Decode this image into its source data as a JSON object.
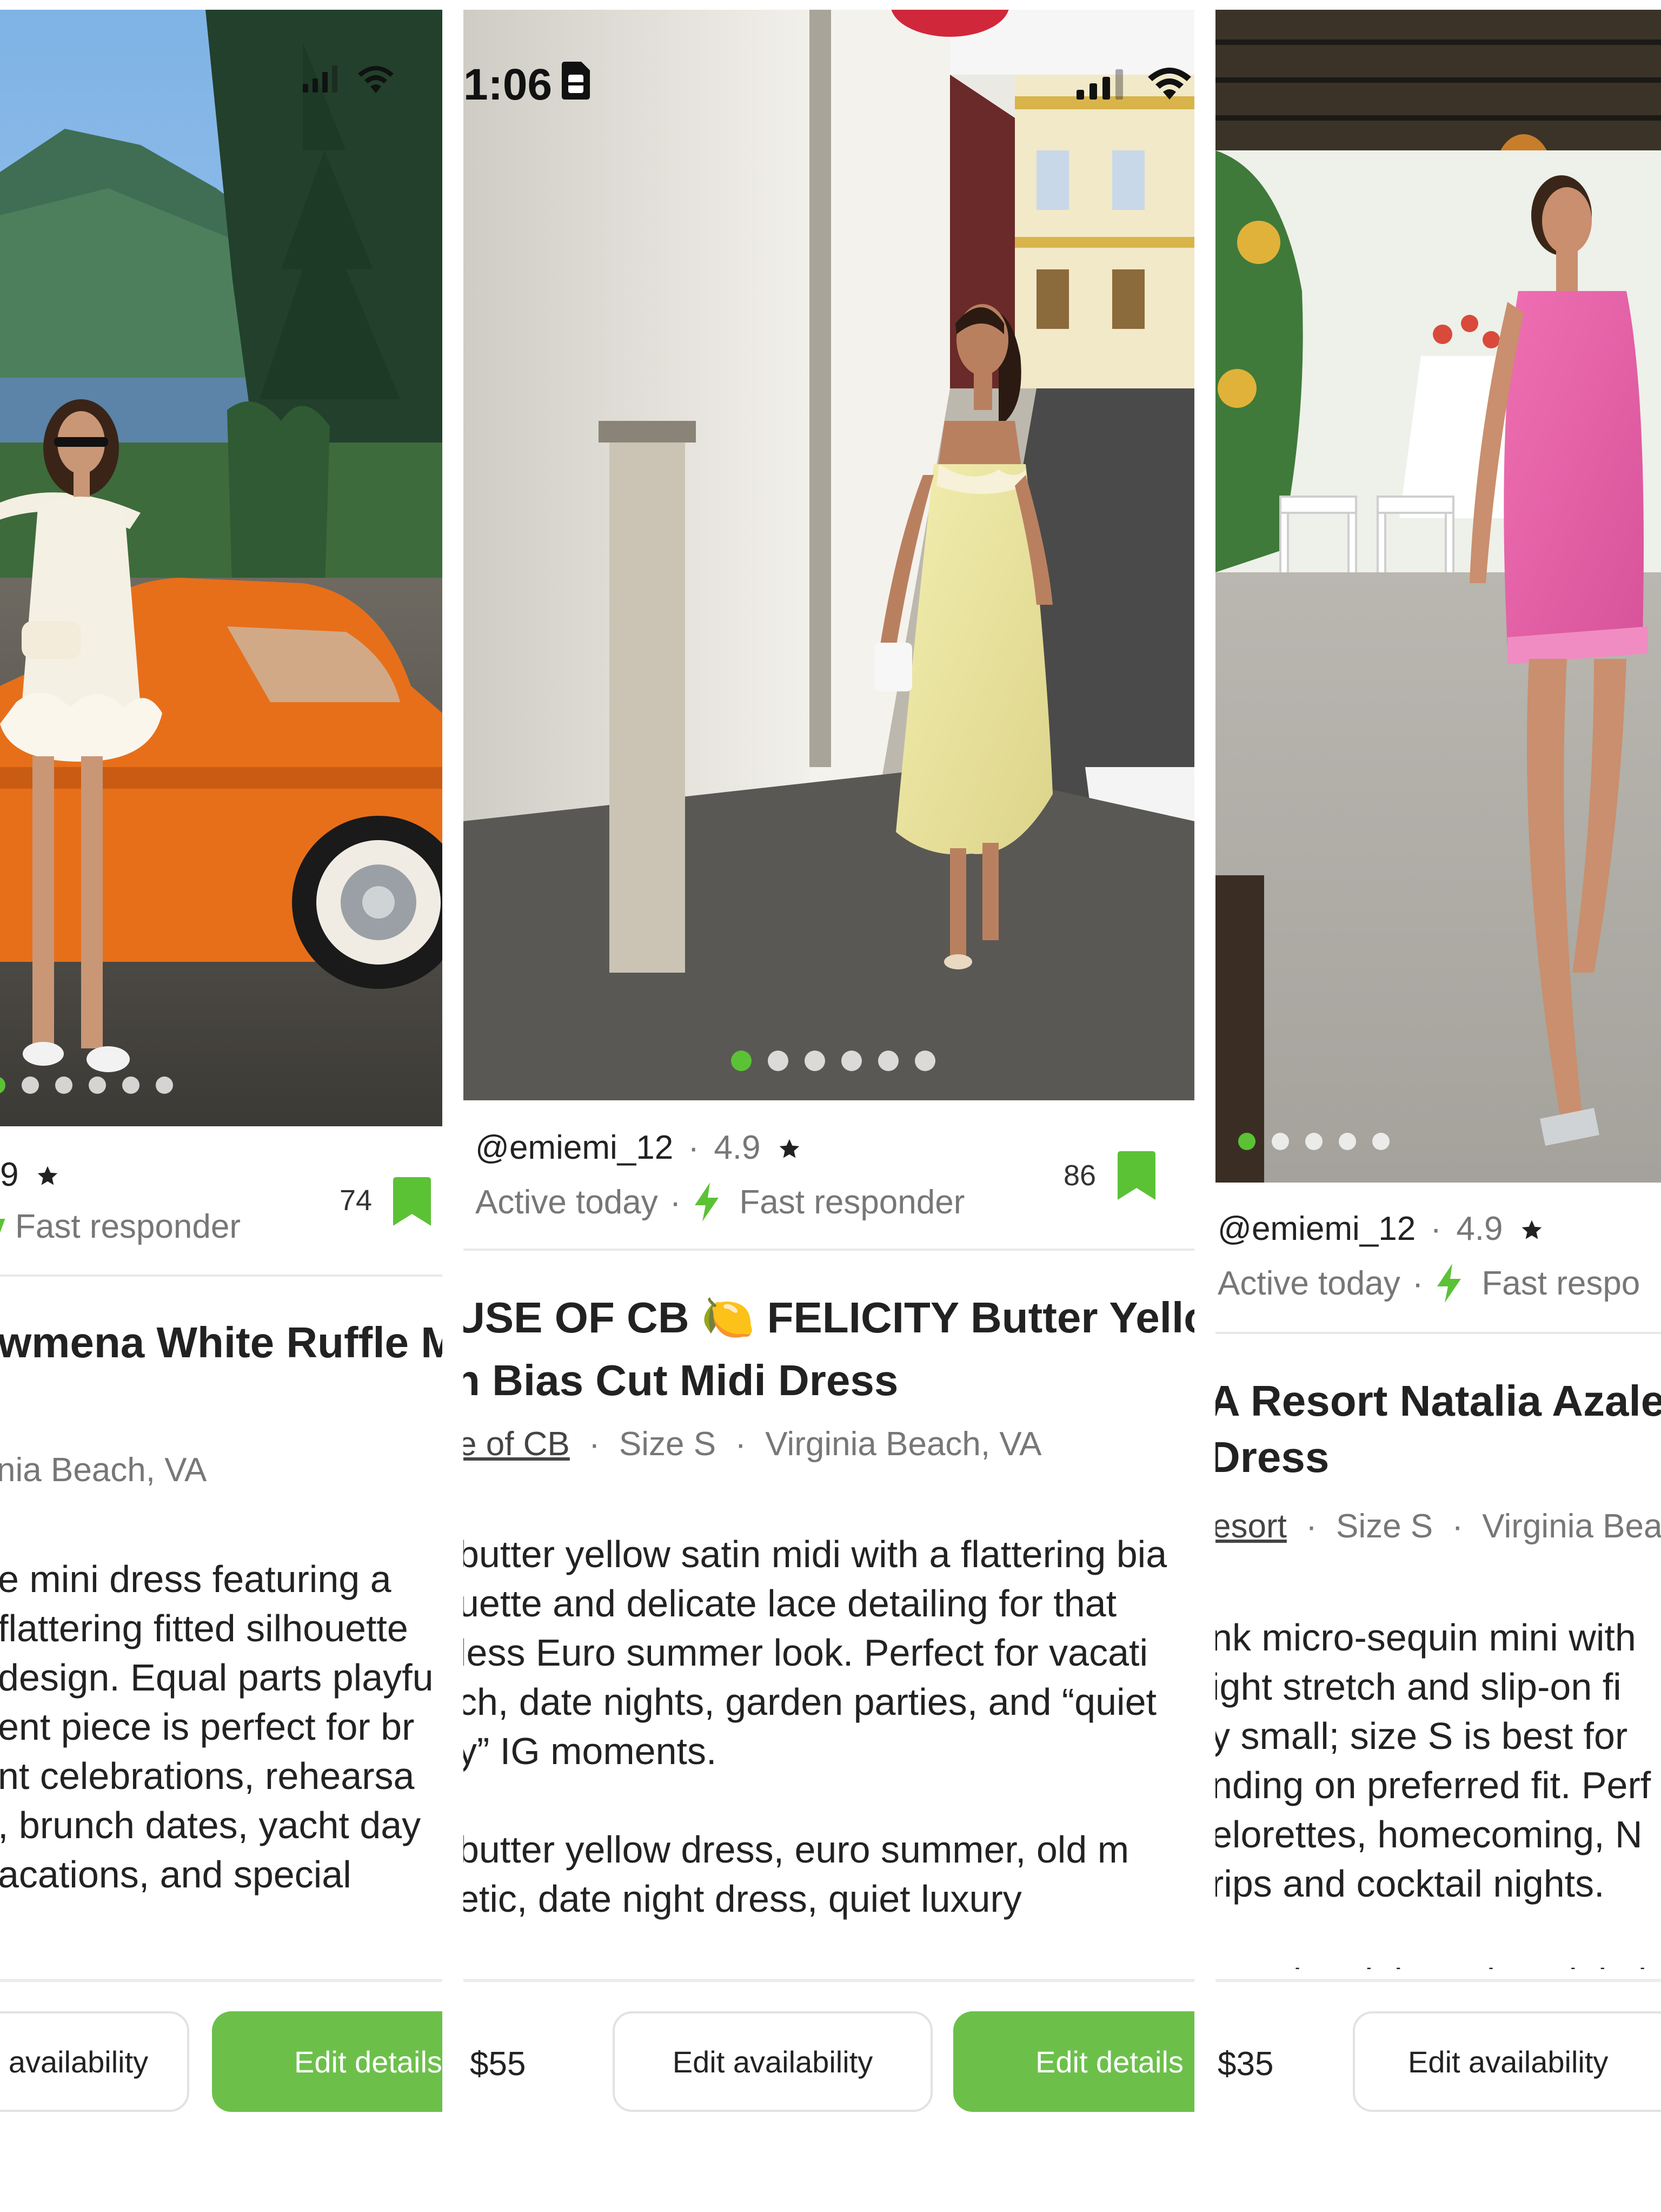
{
  "panels": [
    {
      "status": {
        "signal_icon": "cellular-signal-icon",
        "wifi_icon": "wifi-icon"
      },
      "photo_dots": {
        "count": 6,
        "active_index": 0
      },
      "seller": {
        "rating": "9"
      },
      "badges": {
        "responder": "Fast responder"
      },
      "save_count": "74",
      "title_lines": [
        "wmena White Ruffle M"
      ],
      "meta": {
        "location": "nia Beach, VA"
      },
      "description_lines": [
        "e mini dress featuring a",
        "flattering fitted silhouette",
        "design. Equal parts playfu",
        "ent piece is perfect for br",
        "nt celebrations, rehearsa",
        ", brunch dates, yacht day",
        "acations, and special"
      ],
      "buttons": {
        "availability": "availability",
        "edit": "Edit details"
      }
    },
    {
      "status": {
        "time": "1:06",
        "sim_icon": "sim-card-icon",
        "signal_icon": "cellular-signal-icon",
        "wifi_icon": "wifi-icon"
      },
      "photo_dots": {
        "count": 6,
        "active_index": 0
      },
      "seller": {
        "handle": "@emiemi_12",
        "separator": "·",
        "rating": "4.9"
      },
      "badges": {
        "activity": "Active today",
        "separator": "·",
        "responder": "Fast responder"
      },
      "save_count": "86",
      "title_lines": [
        "USE OF CB 🍋 FELICITY Butter Yello",
        "n Bias Cut Midi Dress"
      ],
      "meta": {
        "brand": "e of CB",
        "separator": "·",
        "size": "Size S",
        "location": "Virginia Beach, VA"
      },
      "description_lines": [
        "butter yellow satin midi with a flattering bia",
        "uette and delicate lace detailing for that",
        "less Euro summer look. Perfect for vacati",
        "ch, date nights, garden parties, and “quiet",
        "y” IG moments."
      ],
      "tags_lines": [
        "butter yellow dress, euro summer, old m",
        "etic, date night dress, quiet luxury"
      ],
      "price": "$55",
      "buttons": {
        "availability": "Edit availability",
        "edit": "Edit details"
      }
    },
    {
      "status": {},
      "photo_dots": {
        "count": 6,
        "active_index": 0
      },
      "seller": {
        "handle": "@emiemi_12",
        "separator": "·",
        "rating": "4.9"
      },
      "badges": {
        "activity": "Active today",
        "separator": "·",
        "responder": "Fast respo"
      },
      "title_lines": [
        "A Resort Natalia Azale",
        "Dress"
      ],
      "meta": {
        "brand": "esort",
        "separator": "·",
        "size": "Size S",
        "location": "Virginia Bea"
      },
      "description_lines": [
        "nk micro-sequin mini with",
        "ight stretch and slip-on fi",
        "y small; size S is best for",
        "nding on preferred fit. Perf",
        "elorettes, homecoming, N",
        "rips and cocktail nights."
      ],
      "tags_lines": [
        "sequin mini, Azalea pink, b"
      ],
      "price": "$35",
      "buttons": {
        "availability": "Edit availability"
      }
    }
  ],
  "colors": {
    "accent_green": "#6cc04a",
    "dot_active": "#5bc236",
    "text_primary": "#222222",
    "text_muted": "#777777",
    "divider": "#e8e8e8"
  }
}
